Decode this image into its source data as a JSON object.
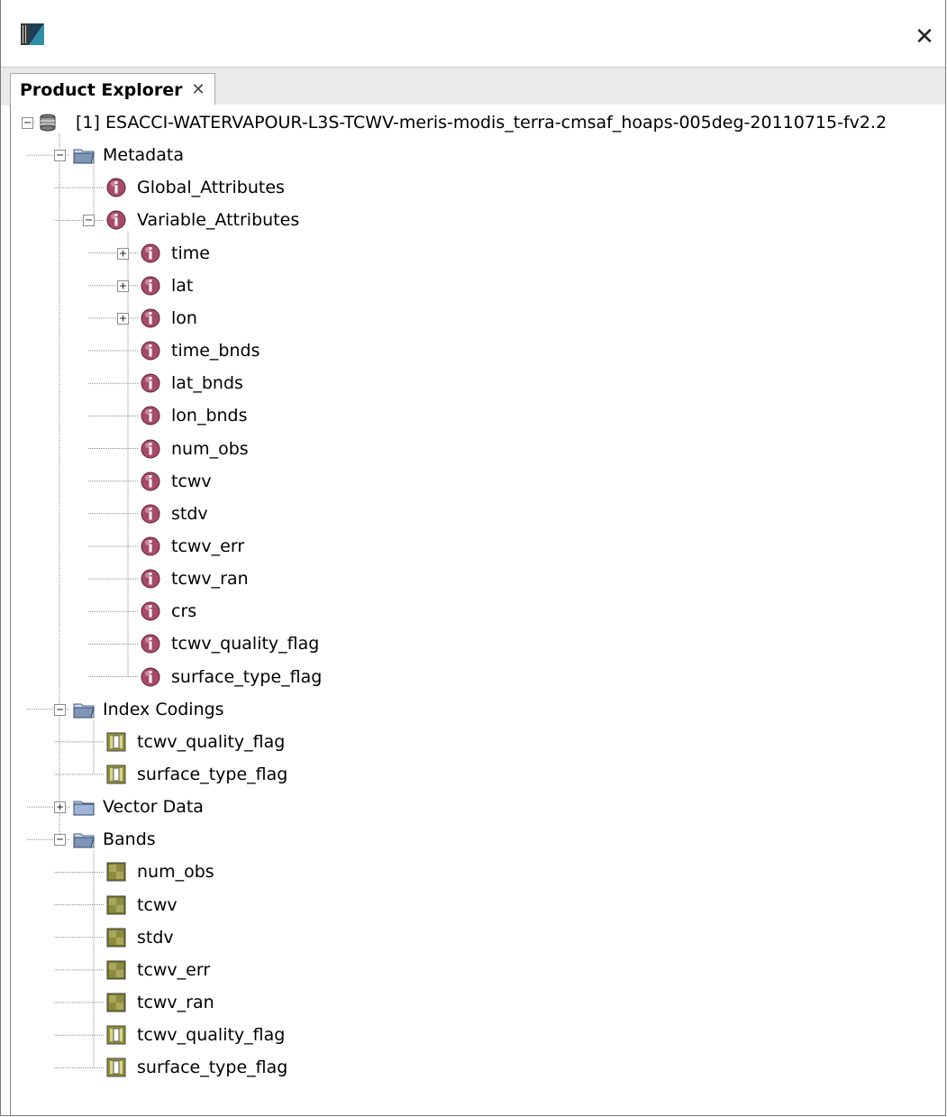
{
  "window": {
    "close_glyph": "✕"
  },
  "tab": {
    "title": "Product Explorer",
    "close_glyph": "✕"
  },
  "tree": {
    "nodes": [
      {
        "label": "[1] ESACCI-WATERVAPOUR-L3S-TCWV-meris-modis_terra-cmsaf_hoaps-005deg-20110715-fv2.2",
        "icon": "database-icon",
        "level": 0,
        "expander": "collapse"
      },
      {
        "label": "Metadata",
        "icon": "folder-open-icon",
        "level": 1,
        "expander": "collapse"
      },
      {
        "label": "Global_Attributes",
        "icon": "info-icon",
        "level": 2,
        "expander": "none"
      },
      {
        "label": "Variable_Attributes",
        "icon": "info-icon",
        "level": 2,
        "expander": "collapse"
      },
      {
        "label": "time",
        "icon": "info-icon",
        "level": 3,
        "expander": "expand"
      },
      {
        "label": "lat",
        "icon": "info-icon",
        "level": 3,
        "expander": "expand"
      },
      {
        "label": "lon",
        "icon": "info-icon",
        "level": 3,
        "expander": "expand"
      },
      {
        "label": "time_bnds",
        "icon": "info-icon",
        "level": 3,
        "expander": "none"
      },
      {
        "label": "lat_bnds",
        "icon": "info-icon",
        "level": 3,
        "expander": "none"
      },
      {
        "label": "lon_bnds",
        "icon": "info-icon",
        "level": 3,
        "expander": "none"
      },
      {
        "label": "num_obs",
        "icon": "info-icon",
        "level": 3,
        "expander": "none"
      },
      {
        "label": "tcwv",
        "icon": "info-icon",
        "level": 3,
        "expander": "none"
      },
      {
        "label": "stdv",
        "icon": "info-icon",
        "level": 3,
        "expander": "none"
      },
      {
        "label": "tcwv_err",
        "icon": "info-icon",
        "level": 3,
        "expander": "none"
      },
      {
        "label": "tcwv_ran",
        "icon": "info-icon",
        "level": 3,
        "expander": "none"
      },
      {
        "label": "crs",
        "icon": "info-icon",
        "level": 3,
        "expander": "none"
      },
      {
        "label": "tcwv_quality_flag",
        "icon": "info-icon",
        "level": 3,
        "expander": "none"
      },
      {
        "label": "surface_type_flag",
        "icon": "info-icon",
        "level": 3,
        "expander": "none"
      },
      {
        "label": "Index Codings",
        "icon": "folder-open-icon",
        "level": 1,
        "expander": "collapse"
      },
      {
        "label": "tcwv_quality_flag",
        "icon": "index-coding-icon",
        "level": 2,
        "expander": "none"
      },
      {
        "label": "surface_type_flag",
        "icon": "index-coding-icon",
        "level": 2,
        "expander": "none"
      },
      {
        "label": "Vector Data",
        "icon": "folder-closed-icon",
        "level": 1,
        "expander": "expand"
      },
      {
        "label": "Bands",
        "icon": "folder-open-icon",
        "level": 1,
        "expander": "collapse"
      },
      {
        "label": "num_obs",
        "icon": "band-icon",
        "level": 2,
        "expander": "none"
      },
      {
        "label": "tcwv",
        "icon": "band-icon",
        "level": 2,
        "expander": "none"
      },
      {
        "label": "stdv",
        "icon": "band-icon",
        "level": 2,
        "expander": "none"
      },
      {
        "label": "tcwv_err",
        "icon": "band-icon",
        "level": 2,
        "expander": "none"
      },
      {
        "label": "tcwv_ran",
        "icon": "band-icon",
        "level": 2,
        "expander": "none"
      },
      {
        "label": "tcwv_quality_flag",
        "icon": "index-coding-icon",
        "level": 2,
        "expander": "none"
      },
      {
        "label": "surface_type_flag",
        "icon": "index-coding-icon",
        "level": 2,
        "expander": "none"
      }
    ]
  }
}
